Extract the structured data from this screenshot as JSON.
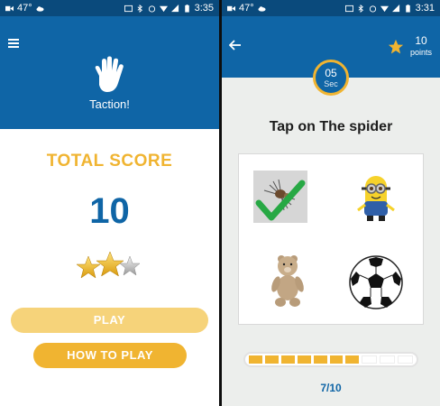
{
  "left_screen": {
    "status_bar": {
      "temperature": "47°",
      "time": "3:35"
    },
    "app_title": "Taction!",
    "score_title": "TOTAL SCORE",
    "score_value": "10",
    "stars_filled": 2,
    "stars_total": 3,
    "play_label": "PLAY",
    "how_to_play_label": "HOW TO PLAY"
  },
  "right_screen": {
    "status_bar": {
      "temperature": "47°",
      "time": "3:31"
    },
    "points_value": "10",
    "points_label": "points",
    "timer_value": "05",
    "timer_unit": "Sec",
    "question": "Tap on The spider",
    "answers": [
      {
        "name": "spider",
        "state": "correct"
      },
      {
        "name": "minion",
        "state": "none"
      },
      {
        "name": "teddy-bear",
        "state": "none"
      },
      {
        "name": "soccer-ball",
        "state": "none"
      }
    ],
    "progress": {
      "completed": 7,
      "total": 10
    },
    "progress_text": "7/10"
  },
  "colors": {
    "primary": "#0f65a6",
    "accent": "#f0b431",
    "status_bar": "#0a4a7c"
  }
}
